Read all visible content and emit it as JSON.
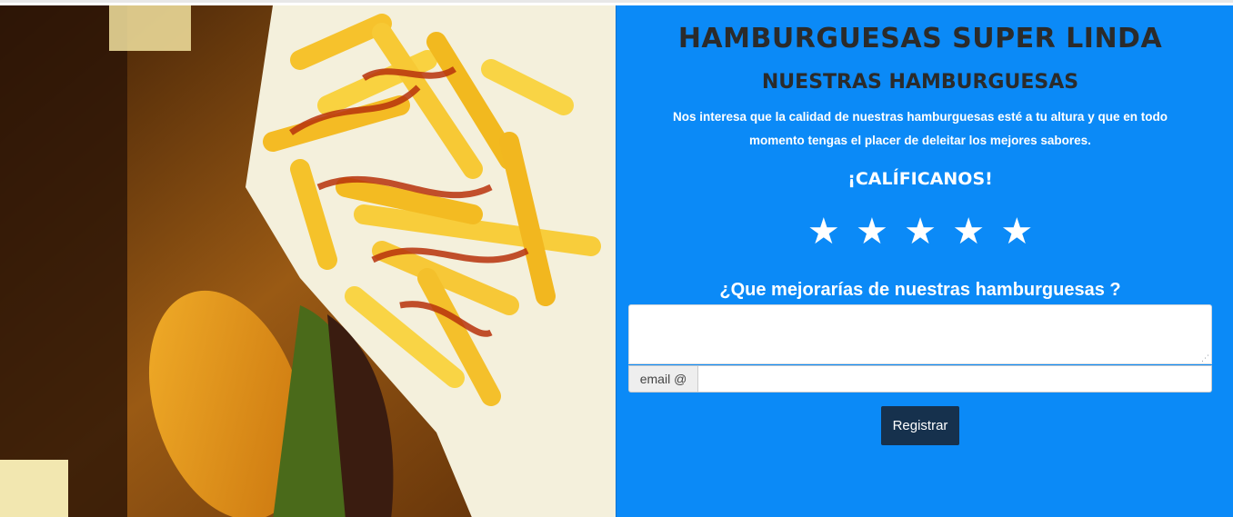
{
  "header": {
    "title": "HAMBURGUESAS SUPER LINDA",
    "subtitle": "NUESTRAS HAMBURGUESAS"
  },
  "description": "Nos interesa que la calidad de nuestras hamburguesas esté a tu altura y que en todo momento tengas el placer de deleitar los mejores sabores.",
  "rating": {
    "heading": "¡CALÍFICANOS!",
    "stars": [
      "★",
      "★",
      "★",
      "★",
      "★"
    ]
  },
  "form": {
    "question": "¿Que mejorarías de nuestras hamburguesas ?",
    "comments_value": "",
    "email_addon": "email @",
    "email_value": "",
    "submit_label": "Registrar"
  },
  "colors": {
    "panel_background": "#0b8af7",
    "heading_text": "#2b2b2b",
    "button_background": "#16314d"
  },
  "photo": {
    "subject": "burger-and-fries-photo"
  }
}
